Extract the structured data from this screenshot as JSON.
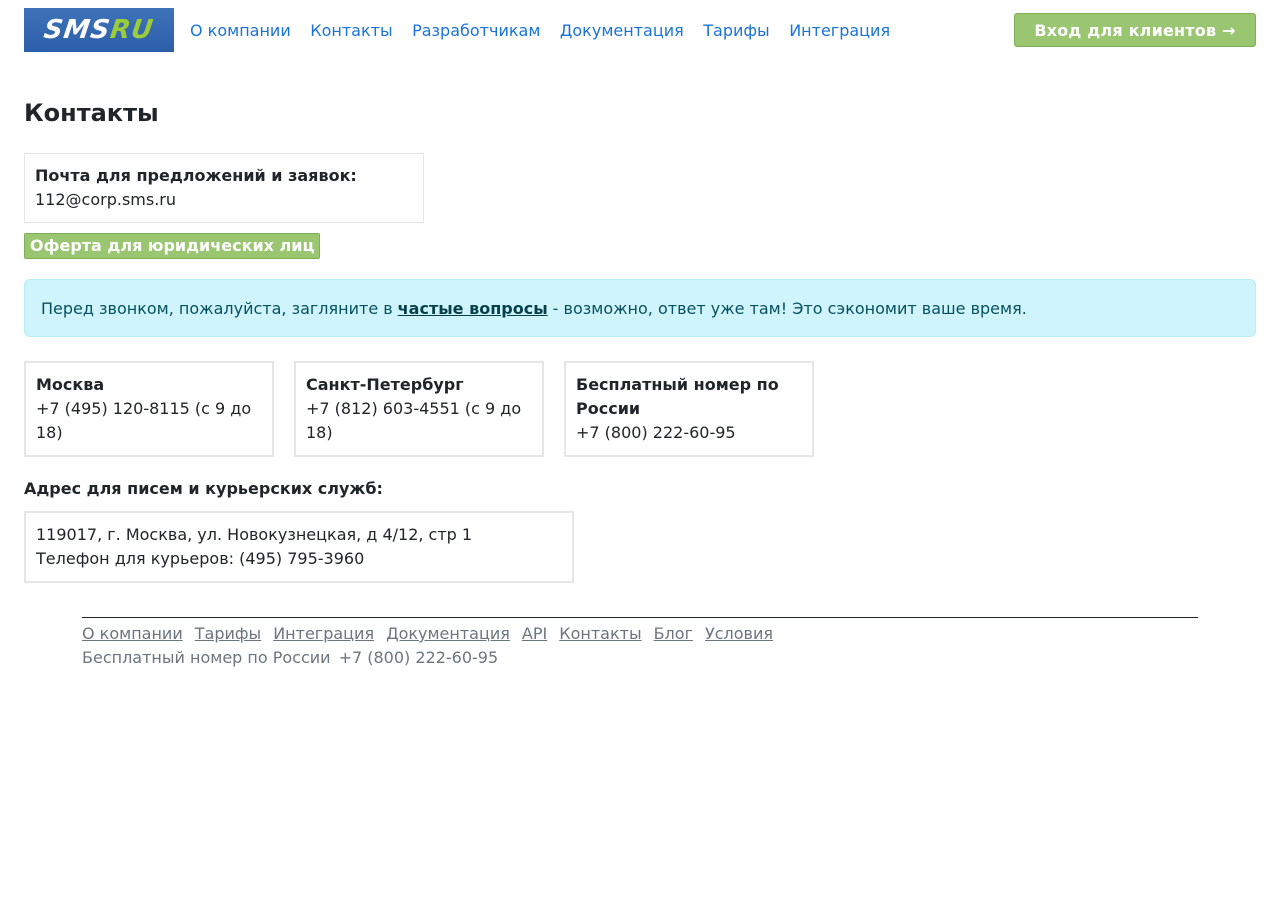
{
  "header": {
    "logo_sms": "SMS",
    "logo_ru": "RU",
    "nav": [
      "О компании",
      "Контакты",
      "Разработчикам",
      "Документация",
      "Тарифы",
      "Интеграция"
    ],
    "login_label": "Вход для клиентов →"
  },
  "page": {
    "title": "Контакты"
  },
  "mail": {
    "label": "Почта для предложений и заявок:",
    "value": "112@corp.sms.ru"
  },
  "offer_label": "Оферта для юридических лиц",
  "alert": {
    "before": "Перед звонком, пожалуйста, загляните в",
    "link": "частые вопросы",
    "after": "- возможно, ответ уже там! Это сэкономит ваше время."
  },
  "phones": [
    {
      "city": "Москва",
      "phone": "+7 (495) 120-8115 (с 9 до 18)"
    },
    {
      "city": "Санкт-Петербург",
      "phone": "+7 (812) 603-4551 (с 9 до 18)"
    },
    {
      "city": "Бесплатный номер по России",
      "phone": "+7 (800) 222-60-95"
    }
  ],
  "address": {
    "label": "Адрес для писем и курьерских служб:",
    "line1": "119017, г. Москва, ул. Новокузнецкая, д 4/12, стр 1",
    "line2": "Телефон для курьеров: (495) 795-3960"
  },
  "footer": {
    "links": [
      "О компании",
      "Тарифы",
      "Интеграция",
      "Документация",
      "API",
      "Контакты",
      "Блог",
      "Условия"
    ],
    "phone_label": "Бесплатный номер по России",
    "phone": "+7 (800) 222-60-95"
  },
  "colors": {
    "accent_green": "#9ac672",
    "link_blue": "#1a73d9",
    "logo_blue": "#2b5ea8",
    "alert_bg": "#cff4fc"
  }
}
